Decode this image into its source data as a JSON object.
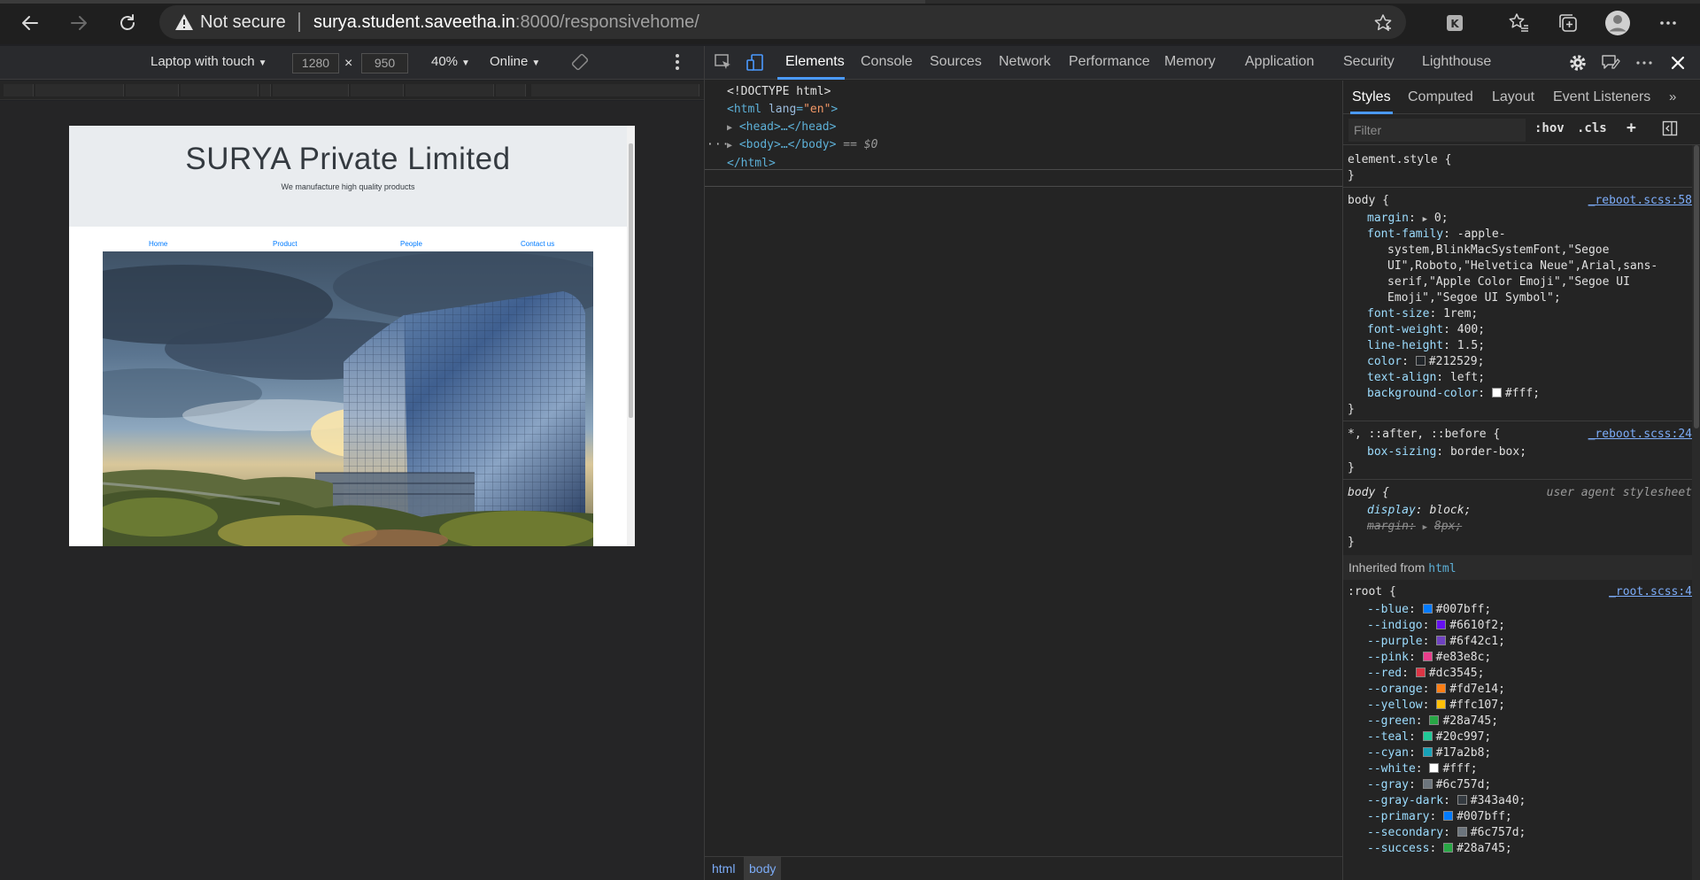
{
  "browser": {
    "security_label": "Not secure",
    "url_host": "surya.student.saveetha.in",
    "url_rest": ":8000/responsivehome/"
  },
  "device_toolbar": {
    "device": "Laptop with touch",
    "width": "1280",
    "height": "950",
    "times": "×",
    "zoom": "40%",
    "network": "Online"
  },
  "emulated_page": {
    "title": "SURYA Private Limited",
    "tagline": "We manufacture high quality products",
    "nav": [
      "Home",
      "Product",
      "People",
      "Contact us"
    ]
  },
  "devtools": {
    "tabs": [
      "Elements",
      "Console",
      "Sources",
      "Network",
      "Performance",
      "Memory",
      "Application",
      "Security",
      "Lighthouse"
    ],
    "active_tab": "Elements",
    "dom": {
      "doctype": "<!DOCTYPE html>",
      "html_open_tag": "<html",
      "html_attr": "lang",
      "html_attr_val": "\"en\"",
      "html_close_bracket": ">",
      "head": "<head>…</head>",
      "body": "<body>…</body>",
      "body_marker": "== $0",
      "html_close": "</html>",
      "ellipsis": "···"
    },
    "breadcrumbs": [
      "html",
      "body"
    ],
    "styles_tabs": [
      "Styles",
      "Computed",
      "Layout",
      "Event Listeners"
    ],
    "filter_placeholder": "Filter",
    "hov": ":hov",
    "cls": ".cls",
    "plus": "+",
    "element_style_open": "element.style {",
    "close_brace": "}",
    "body_rule": {
      "selector": "body {",
      "source": "_reboot.scss:58",
      "margin_prop": "margin",
      "margin_val": "0;",
      "font_family_prop": "font-family",
      "font_family_lines": [
        "-apple-",
        "system,BlinkMacSystemFont,\"Segoe",
        "UI\",Roboto,\"Helvetica Neue\",Arial,sans-",
        "serif,\"Apple Color Emoji\",\"Segoe UI",
        "Emoji\",\"Segoe UI Symbol\";"
      ],
      "font_size_prop": "font-size",
      "font_size_val": "1rem;",
      "font_weight_prop": "font-weight",
      "font_weight_val": "400;",
      "line_height_prop": "line-height",
      "line_height_val": "1.5;",
      "color_prop": "color",
      "color_val": "#212529;",
      "text_align_prop": "text-align",
      "text_align_val": "left;",
      "bg_prop": "background-color",
      "bg_val": "#fff;"
    },
    "universal_rule": {
      "selector": "*, ::after, ::before {",
      "source": "_reboot.scss:24",
      "prop": "box-sizing",
      "val": "border-box;"
    },
    "ua_rule": {
      "selector": "body {",
      "source": "user agent stylesheet",
      "display_prop": "display",
      "display_val": "block;",
      "margin_prop": "margin",
      "margin_val": "8px;"
    },
    "inherited_label": "Inherited from",
    "inherited_tag": "html",
    "root_rule": {
      "selector": ":root {",
      "source": "_root.scss:4",
      "vars": [
        {
          "name": "--blue",
          "value": "#007bff;",
          "color": "#007bff"
        },
        {
          "name": "--indigo",
          "value": "#6610f2;",
          "color": "#6610f2"
        },
        {
          "name": "--purple",
          "value": "#6f42c1;",
          "color": "#6f42c1"
        },
        {
          "name": "--pink",
          "value": "#e83e8c;",
          "color": "#e83e8c"
        },
        {
          "name": "--red",
          "value": "#dc3545;",
          "color": "#dc3545"
        },
        {
          "name": "--orange",
          "value": "#fd7e14;",
          "color": "#fd7e14"
        },
        {
          "name": "--yellow",
          "value": "#ffc107;",
          "color": "#ffc107"
        },
        {
          "name": "--green",
          "value": "#28a745;",
          "color": "#28a745"
        },
        {
          "name": "--teal",
          "value": "#20c997;",
          "color": "#20c997"
        },
        {
          "name": "--cyan",
          "value": "#17a2b8;",
          "color": "#17a2b8"
        },
        {
          "name": "--white",
          "value": "#fff;",
          "color": "#ffffff"
        },
        {
          "name": "--gray",
          "value": "#6c757d;",
          "color": "#6c757d"
        },
        {
          "name": "--gray-dark",
          "value": "#343a40;",
          "color": "#343a40"
        },
        {
          "name": "--primary",
          "value": "#007bff;",
          "color": "#007bff"
        },
        {
          "name": "--secondary",
          "value": "#6c757d;",
          "color": "#6c757d"
        },
        {
          "name": "--success",
          "value": "#28a745;",
          "color": "#28a745"
        }
      ]
    }
  }
}
